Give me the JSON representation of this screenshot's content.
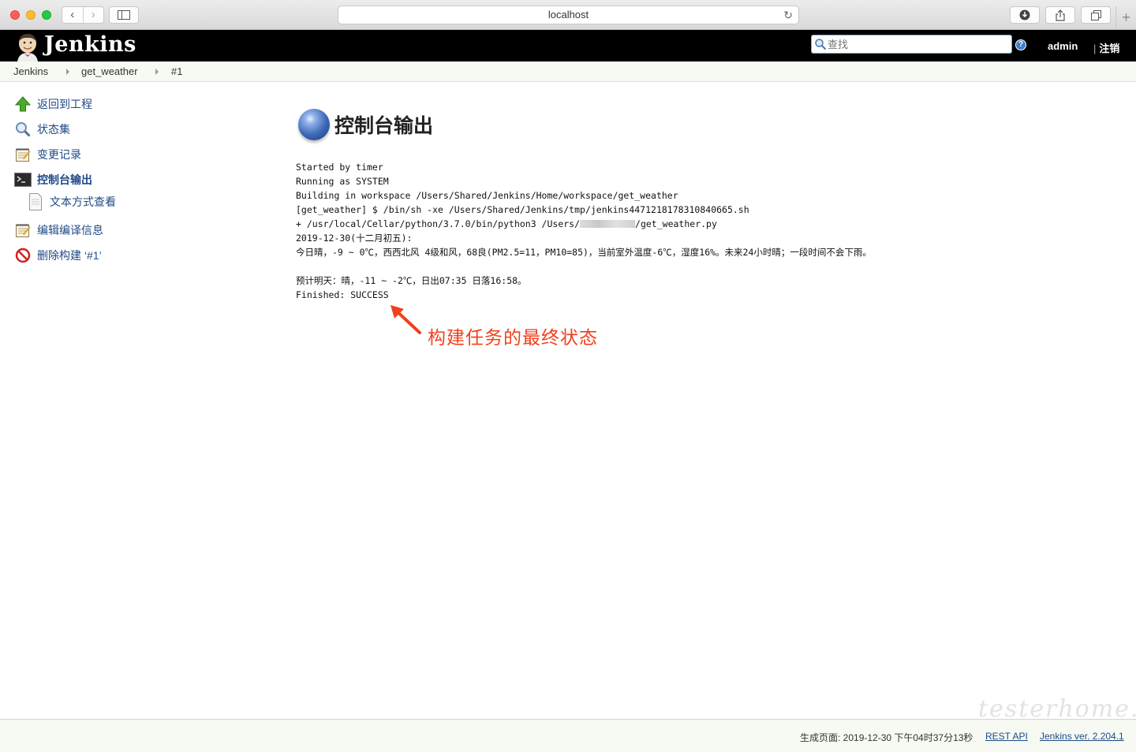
{
  "browser": {
    "url": "localhost",
    "nav_back": "‹",
    "nav_forward": "›",
    "plus": "+"
  },
  "header": {
    "logo_text": "Jenkins",
    "search_placeholder": "查找",
    "help": "?",
    "user": "admin",
    "logout": "注销"
  },
  "breadcrumbs": [
    "Jenkins",
    "get_weather",
    "#1"
  ],
  "sidebar": {
    "items": [
      {
        "label": "返回到工程",
        "icon": "up-arrow-icon"
      },
      {
        "label": "状态集",
        "icon": "magnifier-icon"
      },
      {
        "label": "变更记录",
        "icon": "notepad-icon"
      },
      {
        "label": "控制台输出",
        "icon": "terminal-icon"
      },
      {
        "label": "文本方式查看",
        "icon": "document-icon"
      },
      {
        "label": "编辑编译信息",
        "icon": "notepad-icon"
      },
      {
        "label": "删除构建 ‘#1’",
        "icon": "no-entry-icon"
      }
    ]
  },
  "main": {
    "title": "控制台输出",
    "console": {
      "line1": "Started by timer",
      "line2": "Running as SYSTEM",
      "line3": "Building in workspace /Users/Shared/Jenkins/Home/workspace/get_weather",
      "line4": "[get_weather] $ /bin/sh -xe /Users/Shared/Jenkins/tmp/jenkins4471218178310840665.sh",
      "line5_pre": "+ /usr/local/Cellar/python/3.7.0/bin/python3 /Users/",
      "line5_post": "/get_weather.py",
      "line6": "2019-12-30(十二月初五):",
      "line7": "今日晴，-9 ~ 0℃，西西北风 4级和风，68良(PM2.5=11，PM10=85)，当前室外温度-6℃，湿度16%。未来24小时晴；一段时间不会下雨。",
      "line8": "",
      "line9": "预计明天：晴，-11 ~ -2℃，日出07:35 日落16:58。",
      "line10": "Finished: SUCCESS"
    },
    "annotation": "构建任务的最终状态"
  },
  "footer": {
    "generated": "生成页面: 2019-12-30 下午04时37分13秒",
    "rest_api": "REST API",
    "version": "Jenkins ver. 2.204.1"
  },
  "watermark": "testerhome.com",
  "colors": {
    "header_bg": "#000000",
    "link": "#204a87",
    "annotation": "#f0401e",
    "breadcrumb_bg": "#f6faf2"
  }
}
